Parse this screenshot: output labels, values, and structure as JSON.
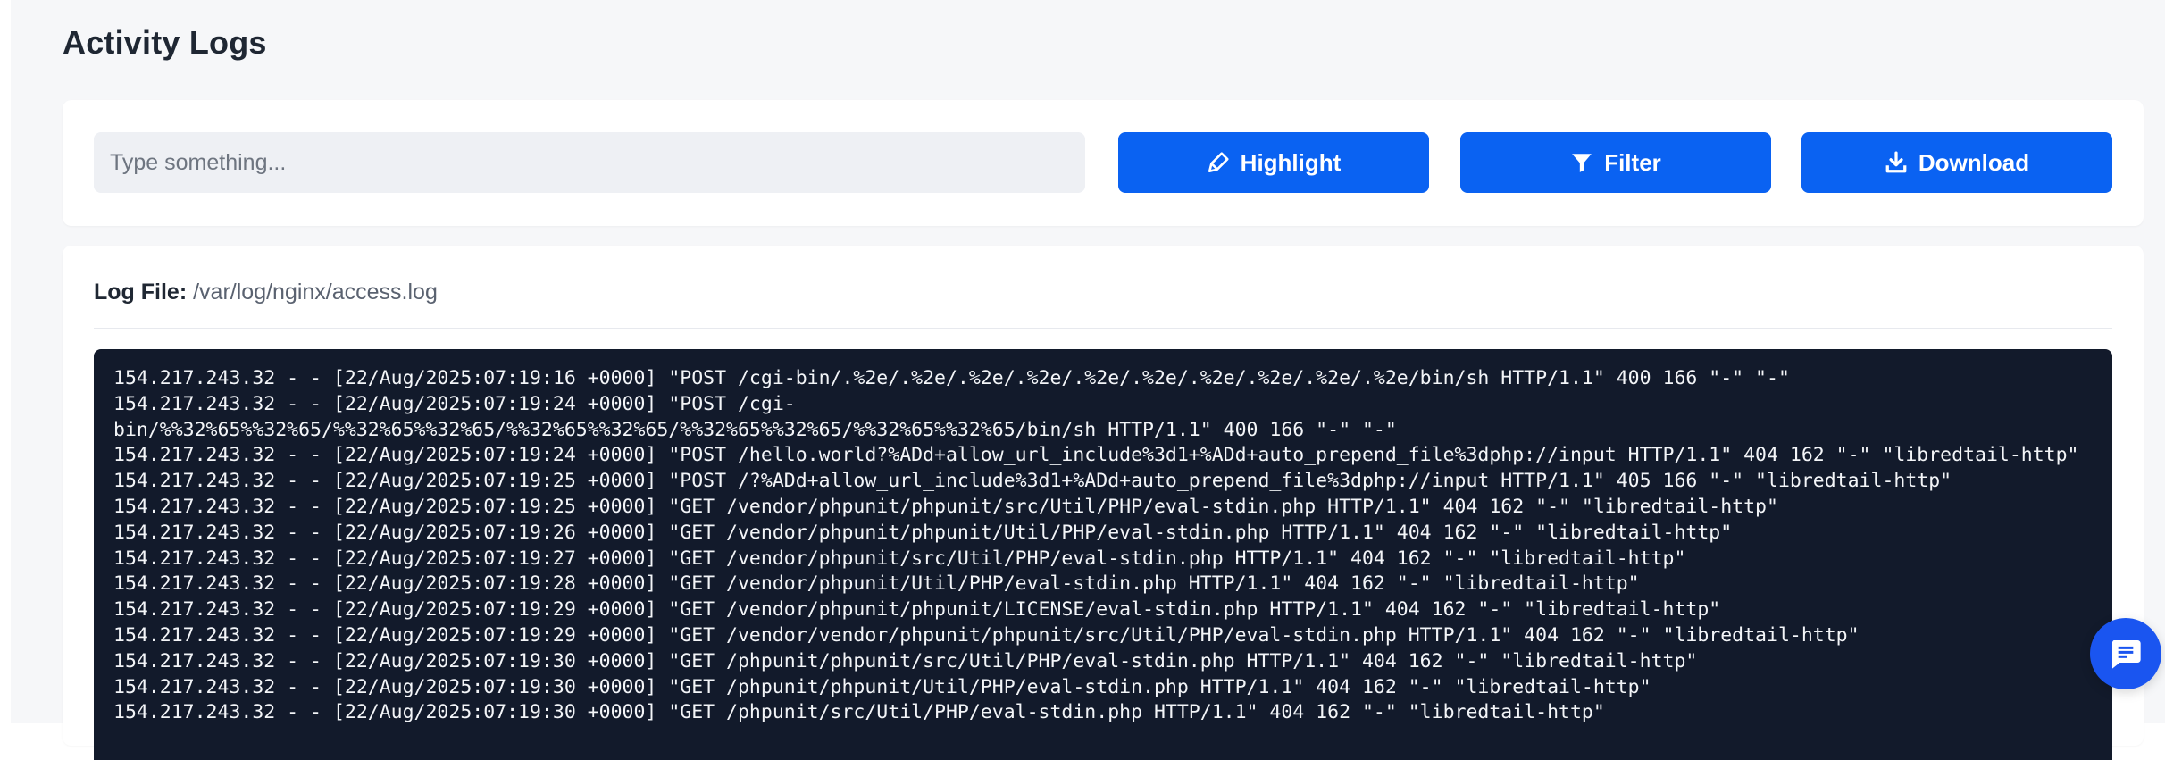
{
  "page": {
    "title": "Activity Logs"
  },
  "controls": {
    "search_placeholder": "Type something...",
    "search_value": "",
    "highlight_label": "Highlight",
    "filter_label": "Filter",
    "download_label": "Download",
    "accent_color": "#0a62f2"
  },
  "log": {
    "file_label": "Log File:",
    "file_path": "/var/log/nginx/access.log",
    "lines": [
      "154.217.243.32 - - [22/Aug/2025:07:19:16 +0000] \"POST /cgi-bin/.%2e/.%2e/.%2e/.%2e/.%2e/.%2e/.%2e/.%2e/.%2e/.%2e/bin/sh HTTP/1.1\" 400 166 \"-\" \"-\"",
      "154.217.243.32 - - [22/Aug/2025:07:19:24 +0000] \"POST /cgi-",
      "bin/%%32%65%%32%65/%%32%65%%32%65/%%32%65%%32%65/%%32%65%%32%65/%%32%65%%32%65/bin/sh HTTP/1.1\" 400 166 \"-\" \"-\"",
      "154.217.243.32 - - [22/Aug/2025:07:19:24 +0000] \"POST /hello.world?%ADd+allow_url_include%3d1+%ADd+auto_prepend_file%3dphp://input HTTP/1.1\" 404 162 \"-\" \"libredtail-http\"",
      "154.217.243.32 - - [22/Aug/2025:07:19:25 +0000] \"POST /?%ADd+allow_url_include%3d1+%ADd+auto_prepend_file%3dphp://input HTTP/1.1\" 405 166 \"-\" \"libredtail-http\"",
      "154.217.243.32 - - [22/Aug/2025:07:19:25 +0000] \"GET /vendor/phpunit/phpunit/src/Util/PHP/eval-stdin.php HTTP/1.1\" 404 162 \"-\" \"libredtail-http\"",
      "154.217.243.32 - - [22/Aug/2025:07:19:26 +0000] \"GET /vendor/phpunit/phpunit/Util/PHP/eval-stdin.php HTTP/1.1\" 404 162 \"-\" \"libredtail-http\"",
      "154.217.243.32 - - [22/Aug/2025:07:19:27 +0000] \"GET /vendor/phpunit/src/Util/PHP/eval-stdin.php HTTP/1.1\" 404 162 \"-\" \"libredtail-http\"",
      "154.217.243.32 - - [22/Aug/2025:07:19:28 +0000] \"GET /vendor/phpunit/Util/PHP/eval-stdin.php HTTP/1.1\" 404 162 \"-\" \"libredtail-http\"",
      "154.217.243.32 - - [22/Aug/2025:07:19:29 +0000] \"GET /vendor/phpunit/phpunit/LICENSE/eval-stdin.php HTTP/1.1\" 404 162 \"-\" \"libredtail-http\"",
      "154.217.243.32 - - [22/Aug/2025:07:19:29 +0000] \"GET /vendor/vendor/phpunit/phpunit/src/Util/PHP/eval-stdin.php HTTP/1.1\" 404 162 \"-\" \"libredtail-http\"",
      "154.217.243.32 - - [22/Aug/2025:07:19:30 +0000] \"GET /phpunit/phpunit/src/Util/PHP/eval-stdin.php HTTP/1.1\" 404 162 \"-\" \"libredtail-http\"",
      "154.217.243.32 - - [22/Aug/2025:07:19:30 +0000] \"GET /phpunit/phpunit/Util/PHP/eval-stdin.php HTTP/1.1\" 404 162 \"-\" \"libredtail-http\"",
      "154.217.243.32 - - [22/Aug/2025:07:19:30 +0000] \"GET /phpunit/src/Util/PHP/eval-stdin.php HTTP/1.1\" 404 162 \"-\" \"libredtail-http\""
    ]
  },
  "icons": {
    "highlight": "highlighter-pen-icon",
    "filter": "funnel-icon",
    "download": "download-icon",
    "chat": "chat-bubble-icon"
  }
}
